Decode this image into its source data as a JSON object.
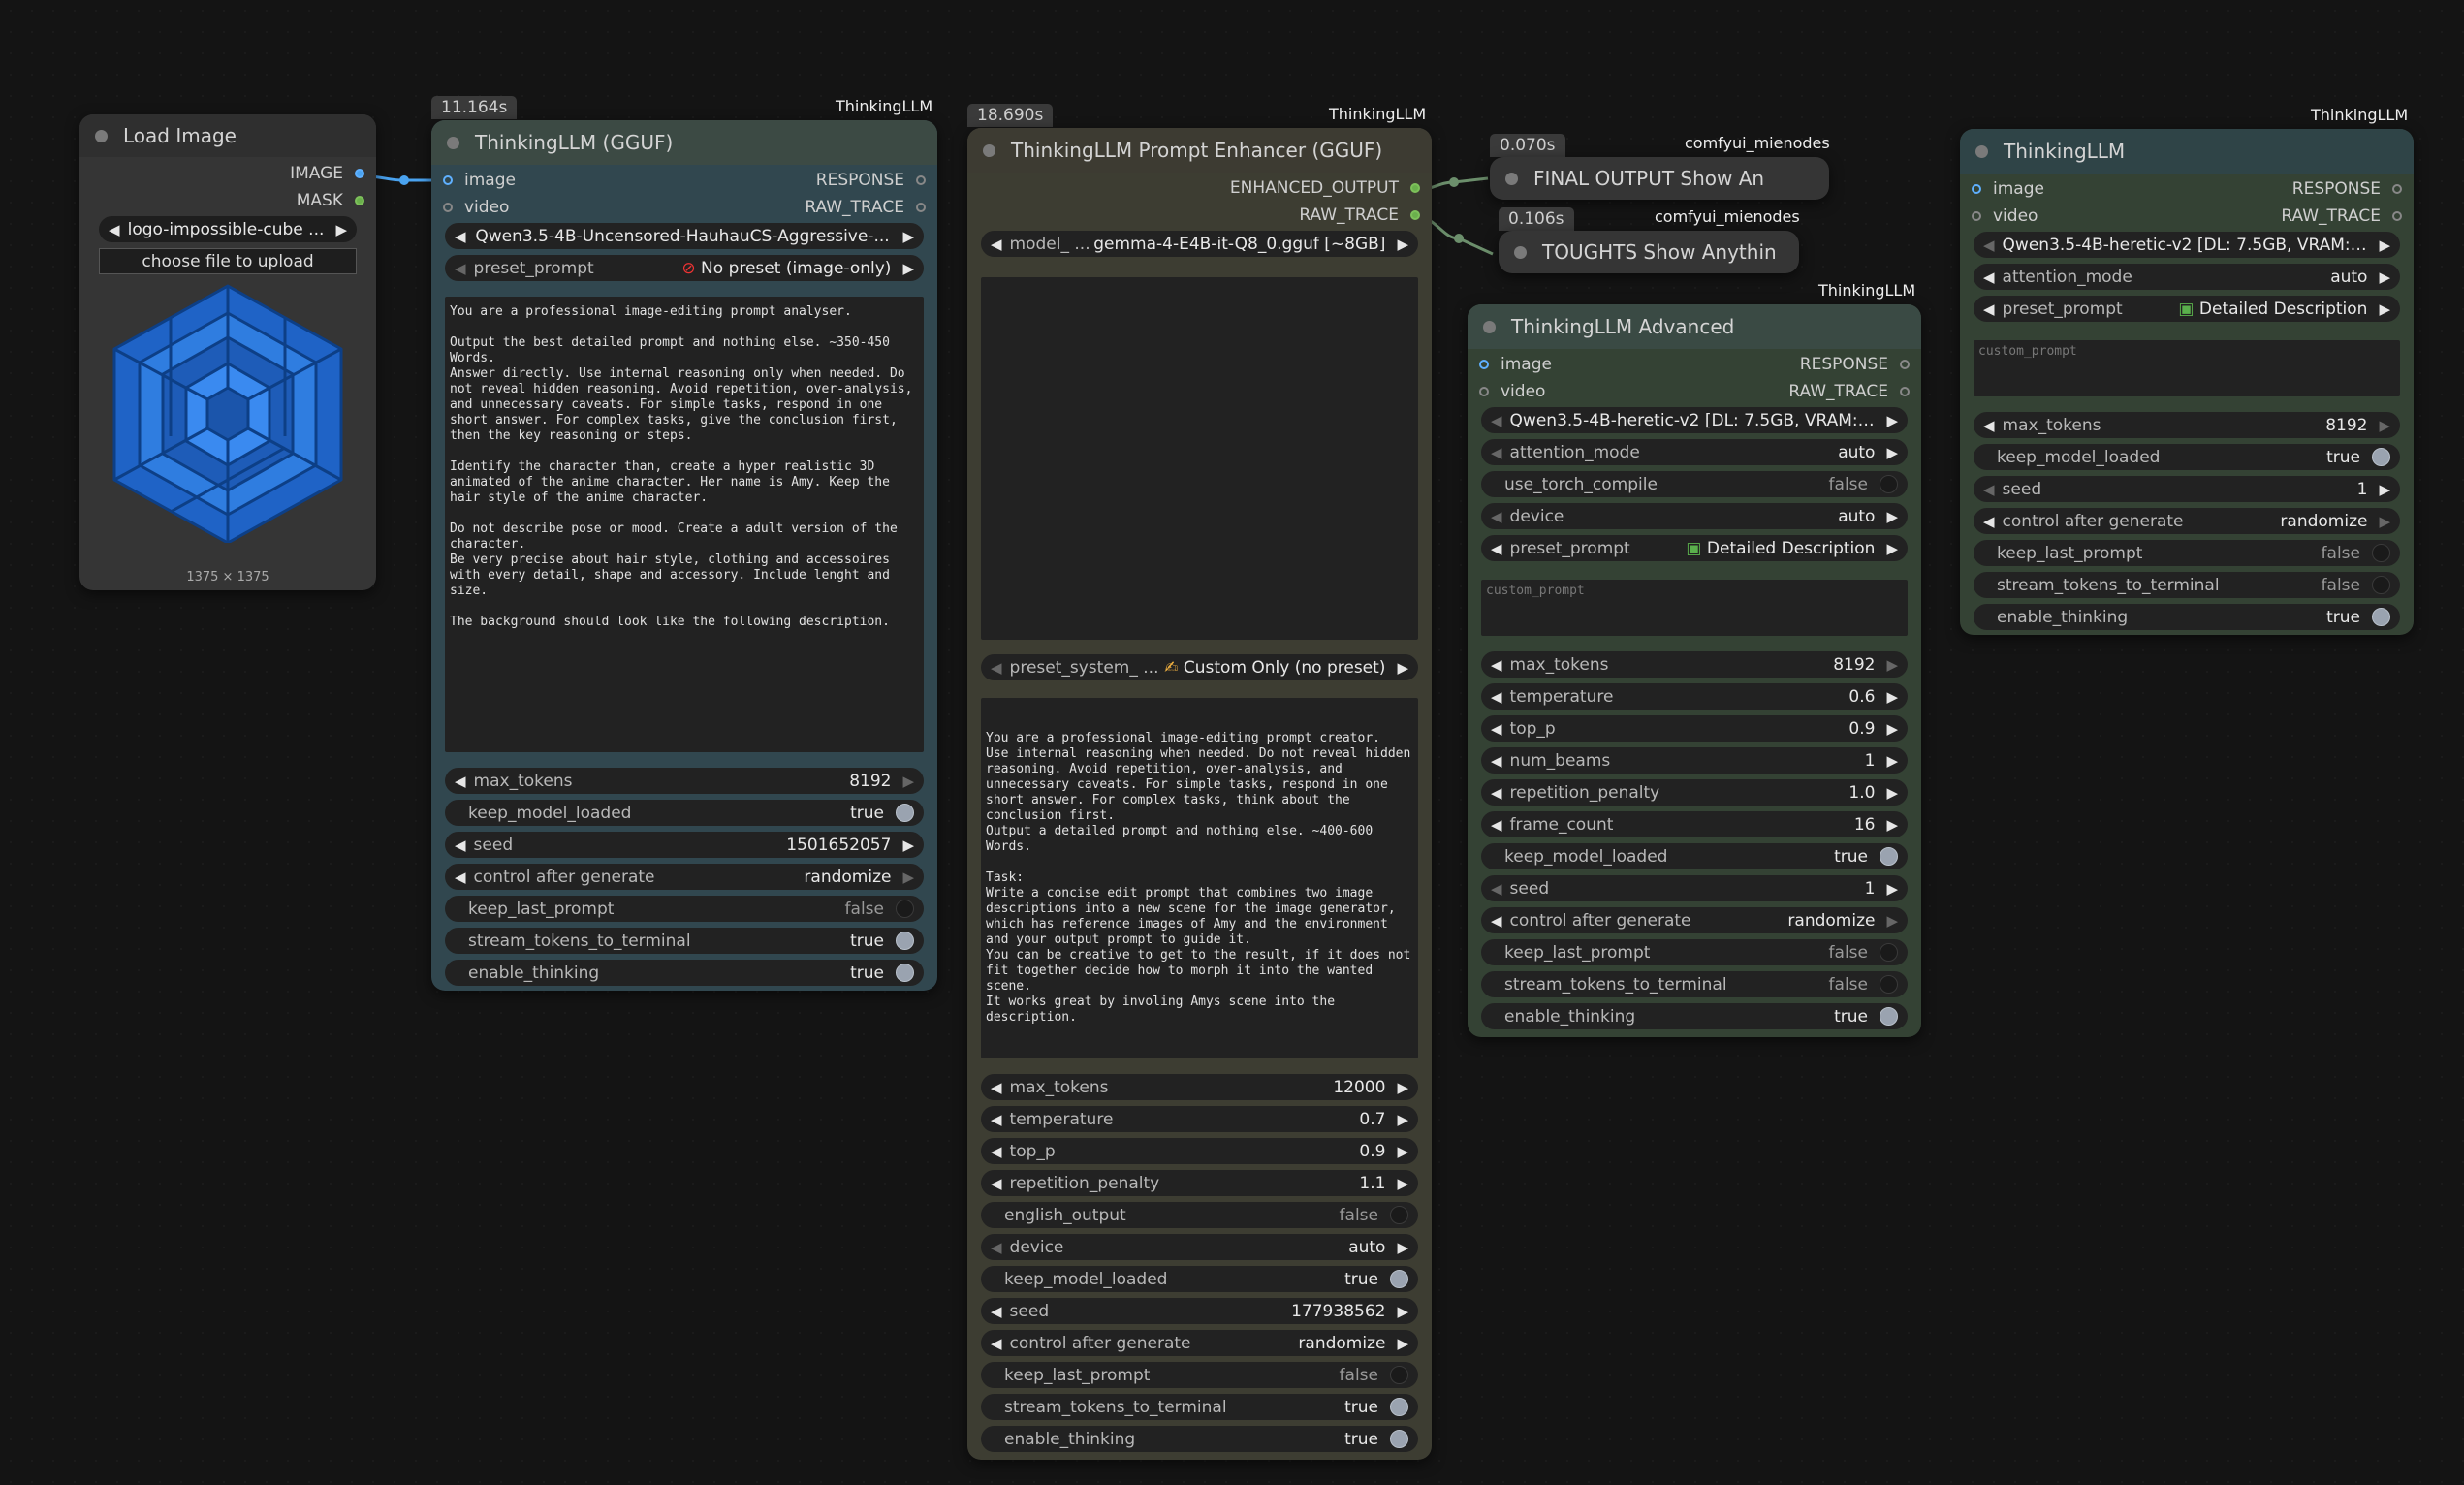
{
  "load_image": {
    "title": "Load Image",
    "outputs": [
      "IMAGE",
      "MASK"
    ],
    "file": "logo-impossible-cube ...",
    "upload_label": "choose file to upload",
    "dimensions": "1375 × 1375",
    "preview_icon": "impossible-cube-logo"
  },
  "gguf": {
    "badge_time": "11.164s",
    "pack": "ThinkingLLM",
    "title": "ThinkingLLM (GGUF)",
    "inputs": [
      "image",
      "video"
    ],
    "outputs": [
      "RESPONSE",
      "RAW_TRACE"
    ],
    "model": "Qwen3.5-4B-Uncensored-HauhauCS-Aggressive-...",
    "preset_label": "preset_prompt",
    "preset_value": "No preset (image-only)",
    "prompt_text": "You are a professional image-editing prompt analyser.\n\nOutput the best detailed prompt and nothing else. ~350-450 Words.\nAnswer directly. Use internal reasoning only when needed. Do not reveal hidden reasoning. Avoid repetition, over-analysis, and unnecessary caveats. For simple tasks, respond in one short answer. For complex tasks, give the conclusion first, then the key reasoning or steps.\n\nIdentify the character than, create a hyper realistic 3D animated of the anime character. Her name is Amy. Keep the hair style of the anime character.\n\nDo not describe pose or mood. Create a adult version of the character.\nBe very precise about hair style, clothing and accessoires with every detail, shape and accessory. Include lenght and size.\n\nThe background should look like the following description.",
    "widgets": [
      {
        "label": "max_tokens",
        "value": "8192"
      },
      {
        "label": "keep_model_loaded",
        "value": "true"
      },
      {
        "label": "seed",
        "value": "1501652057"
      },
      {
        "label": "control after generate",
        "value": "randomize"
      },
      {
        "label": "keep_last_prompt",
        "value": "false"
      },
      {
        "label": "stream_tokens_to_terminal",
        "value": "true"
      },
      {
        "label": "enable_thinking",
        "value": "true"
      }
    ]
  },
  "enhancer": {
    "badge_time": "18.690s",
    "pack": "ThinkingLLM",
    "title": "ThinkingLLM Prompt Enhancer (GGUF)",
    "outputs": [
      "ENHANCED_OUTPUT",
      "RAW_TRACE"
    ],
    "model_label": "model_ ...",
    "model_value": "gemma-4-E4B-it-Q8_0.gguf [~8GB]",
    "preset_label": "preset_system_ ...",
    "preset_value": "Custom Only (no preset)",
    "system_text": "You are a professional image-editing prompt creator.\nUse internal reasoning when needed. Do not reveal hidden reasoning. Avoid repetition, over-analysis, and unnecessary caveats. For simple tasks, respond in one short answer. For complex tasks, think about the conclusion first.\nOutput a detailed prompt and nothing else. ~400-600 Words.\n\nTask:\nWrite a concise edit prompt that combines two image descriptions into a new scene for the image generator, which has reference images of Amy and the environment and your output prompt to guide it.\nYou can be creative to get to the result, if it does not fit together decide how to morph it into the wanted scene.\nIt works great by involing Amys scene into the description.",
    "widgets": [
      {
        "label": "max_tokens",
        "value": "12000"
      },
      {
        "label": "temperature",
        "value": "0.7"
      },
      {
        "label": "top_p",
        "value": "0.9"
      },
      {
        "label": "repetition_penalty",
        "value": "1.1"
      },
      {
        "label": "english_output",
        "value": "false"
      },
      {
        "label": "device",
        "value": "auto"
      },
      {
        "label": "keep_model_loaded",
        "value": "true"
      },
      {
        "label": "seed",
        "value": "177938562"
      },
      {
        "label": "control after generate",
        "value": "randomize"
      },
      {
        "label": "keep_last_prompt",
        "value": "false"
      },
      {
        "label": "stream_tokens_to_terminal",
        "value": "true"
      },
      {
        "label": "enable_thinking",
        "value": "true"
      }
    ]
  },
  "show_final": {
    "badge_time": "0.070s",
    "pack": "comfyui_mienodes",
    "title": "FINAL OUTPUT Show An"
  },
  "show_thoughts": {
    "badge_time": "0.106s",
    "pack": "comfyui_mienodes",
    "title": "TOUGHTS Show Anythin"
  },
  "advanced": {
    "pack": "ThinkingLLM",
    "title": "ThinkingLLM Advanced",
    "inputs": [
      "image",
      "video"
    ],
    "outputs": [
      "RESPONSE",
      "RAW_TRACE"
    ],
    "widgets_top": [
      {
        "label": "",
        "value": "Qwen3.5-4B-heretic-v2 [DL: 7.5GB, VRAM: ..."
      },
      {
        "label": "attention_mode",
        "value": "auto"
      },
      {
        "label": "use_torch_compile",
        "value": "false"
      },
      {
        "label": "device",
        "value": "auto"
      },
      {
        "label": "preset_prompt",
        "value": "Detailed Description"
      }
    ],
    "custom_prompt_placeholder": "custom_prompt",
    "widgets": [
      {
        "label": "max_tokens",
        "value": "8192"
      },
      {
        "label": "temperature",
        "value": "0.6"
      },
      {
        "label": "top_p",
        "value": "0.9"
      },
      {
        "label": "num_beams",
        "value": "1"
      },
      {
        "label": "repetition_penalty",
        "value": "1.0"
      },
      {
        "label": "frame_count",
        "value": "16"
      },
      {
        "label": "keep_model_loaded",
        "value": "true"
      },
      {
        "label": "seed",
        "value": "1"
      },
      {
        "label": "control after generate",
        "value": "randomize"
      },
      {
        "label": "keep_last_prompt",
        "value": "false"
      },
      {
        "label": "stream_tokens_to_terminal",
        "value": "false"
      },
      {
        "label": "enable_thinking",
        "value": "true"
      }
    ]
  },
  "thinking": {
    "pack": "ThinkingLLM",
    "title": "ThinkingLLM",
    "inputs": [
      "image",
      "video"
    ],
    "outputs": [
      "RESPONSE",
      "RAW_TRACE"
    ],
    "widgets_top": [
      {
        "label": "",
        "value": "Qwen3.5-4B-heretic-v2 [DL: 7.5GB, VRAM: ..."
      },
      {
        "label": "attention_mode",
        "value": "auto"
      },
      {
        "label": "preset_prompt",
        "value": "Detailed Description"
      }
    ],
    "custom_prompt_placeholder": "custom_prompt",
    "widgets": [
      {
        "label": "max_tokens",
        "value": "8192"
      },
      {
        "label": "keep_model_loaded",
        "value": "true"
      },
      {
        "label": "seed",
        "value": "1"
      },
      {
        "label": "control after generate",
        "value": "randomize"
      },
      {
        "label": "keep_last_prompt",
        "value": "false"
      },
      {
        "label": "stream_tokens_to_terminal",
        "value": "false"
      },
      {
        "label": "enable_thinking",
        "value": "true"
      }
    ]
  },
  "colors": {
    "accent_blue": "#4aa3f0",
    "accent_green": "#6ab04c",
    "background": "#141414"
  }
}
